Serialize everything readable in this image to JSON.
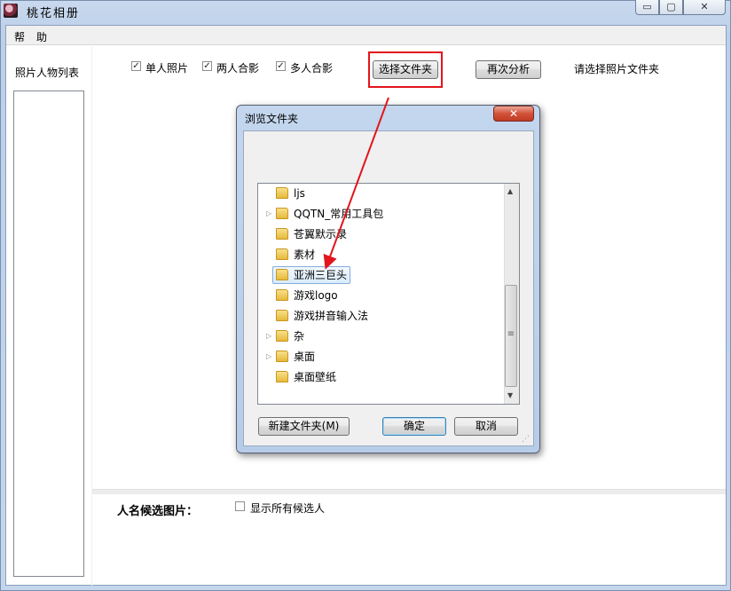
{
  "window": {
    "title": "桃花相册",
    "min_glyph": "▭",
    "max_glyph": "▢",
    "close_glyph": "✕"
  },
  "menu": [
    "帮",
    "助"
  ],
  "sidebar": {
    "label": "照片人物列表"
  },
  "toolbar": {
    "checkboxes": [
      {
        "label": "单人照片",
        "checked": true
      },
      {
        "label": "两人合影",
        "checked": true
      },
      {
        "label": "多人合影",
        "checked": true
      }
    ],
    "choose_folder_label": "选择文件夹",
    "reanalyze_label": "再次分析",
    "status_text": "请选择照片文件夹"
  },
  "bottom": {
    "label": "人名候选图片：",
    "show_all": {
      "label": "显示所有候选人",
      "checked": false
    }
  },
  "dialog": {
    "title": "浏览文件夹",
    "close_glyph": "✕",
    "folders": [
      {
        "name": "ljs",
        "expandable": false,
        "selected": false
      },
      {
        "name": "QQTN_常用工具包",
        "expandable": true,
        "selected": false
      },
      {
        "name": "苍翼默示录",
        "expandable": false,
        "selected": false
      },
      {
        "name": "素材",
        "expandable": false,
        "selected": false
      },
      {
        "name": "亚洲三巨头",
        "expandable": false,
        "selected": true
      },
      {
        "name": "游戏logo",
        "expandable": false,
        "selected": false
      },
      {
        "name": "游戏拼音输入法",
        "expandable": false,
        "selected": false
      },
      {
        "name": "杂",
        "expandable": true,
        "selected": false
      },
      {
        "name": "桌面",
        "expandable": true,
        "selected": false
      },
      {
        "name": "桌面壁纸",
        "expandable": false,
        "selected": false
      }
    ],
    "new_folder_label": "新建文件夹(M)",
    "ok_label": "确定",
    "cancel_label": "取消",
    "scroll_up": "▲",
    "scroll_down": "▼",
    "scroll_grip": "≡",
    "expand_glyph": "▷"
  },
  "annotation": {
    "color": "#e3141b"
  }
}
